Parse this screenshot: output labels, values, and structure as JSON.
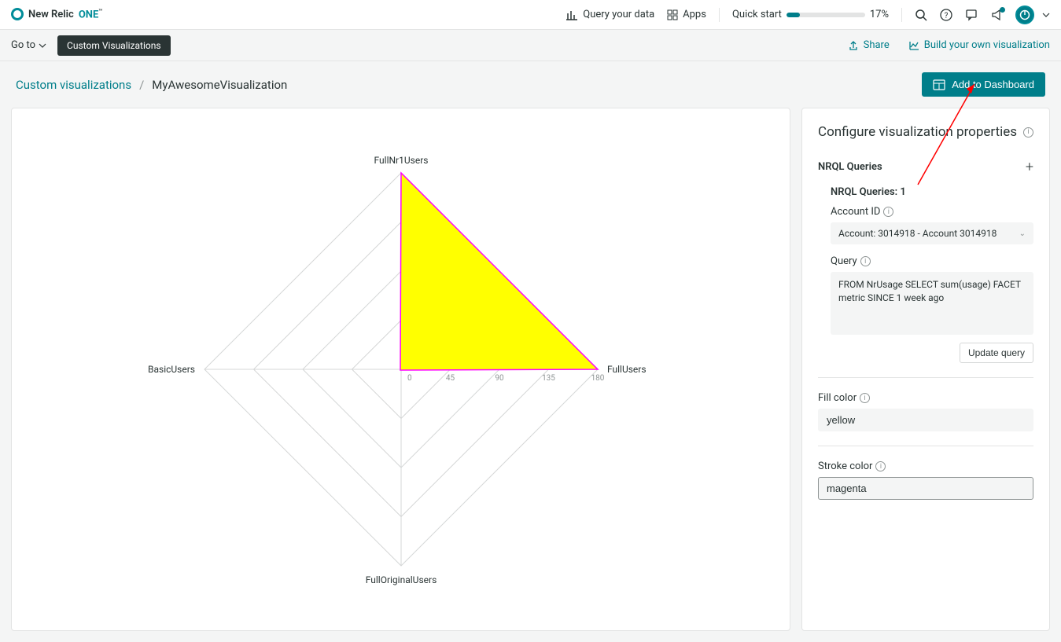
{
  "brand": {
    "name": "New Relic",
    "suffix": "ONE",
    "tm": "™"
  },
  "header": {
    "query_data": "Query your data",
    "apps": "Apps",
    "quick_start": "Quick start",
    "progress_pct": "17%"
  },
  "subheader": {
    "goto": "Go to",
    "badge": "Custom Visualizations",
    "share": "Share",
    "build": "Build your own visualization"
  },
  "breadcrumb": {
    "root": "Custom visualizations",
    "current": "MyAwesomeVisualization"
  },
  "actions": {
    "add_dashboard": "Add to Dashboard"
  },
  "config": {
    "title": "Configure visualization properties",
    "nrql_header": "NRQL Queries",
    "nrql_count": "NRQL Queries: 1",
    "account_label": "Account ID",
    "account_value": "Account: 3014918 - Account 3014918",
    "query_label": "Query",
    "query_value": "FROM NrUsage SELECT sum(usage) FACET metric SINCE 1 week ago",
    "update_query": "Update query",
    "fill_label": "Fill color",
    "fill_value": "yellow",
    "stroke_label": "Stroke color",
    "stroke_value": "magenta"
  },
  "chart_data": {
    "type": "radar",
    "axes": [
      "FullNr1Users",
      "FullUsers",
      "FullOriginalUsers",
      "BasicUsers"
    ],
    "ticks": [
      0,
      45,
      90,
      135,
      180
    ],
    "values": {
      "FullNr1Users": 180,
      "FullUsers": 180,
      "FullOriginalUsers": 0,
      "BasicUsers": 0
    },
    "fill": "yellow",
    "stroke": "magenta"
  }
}
